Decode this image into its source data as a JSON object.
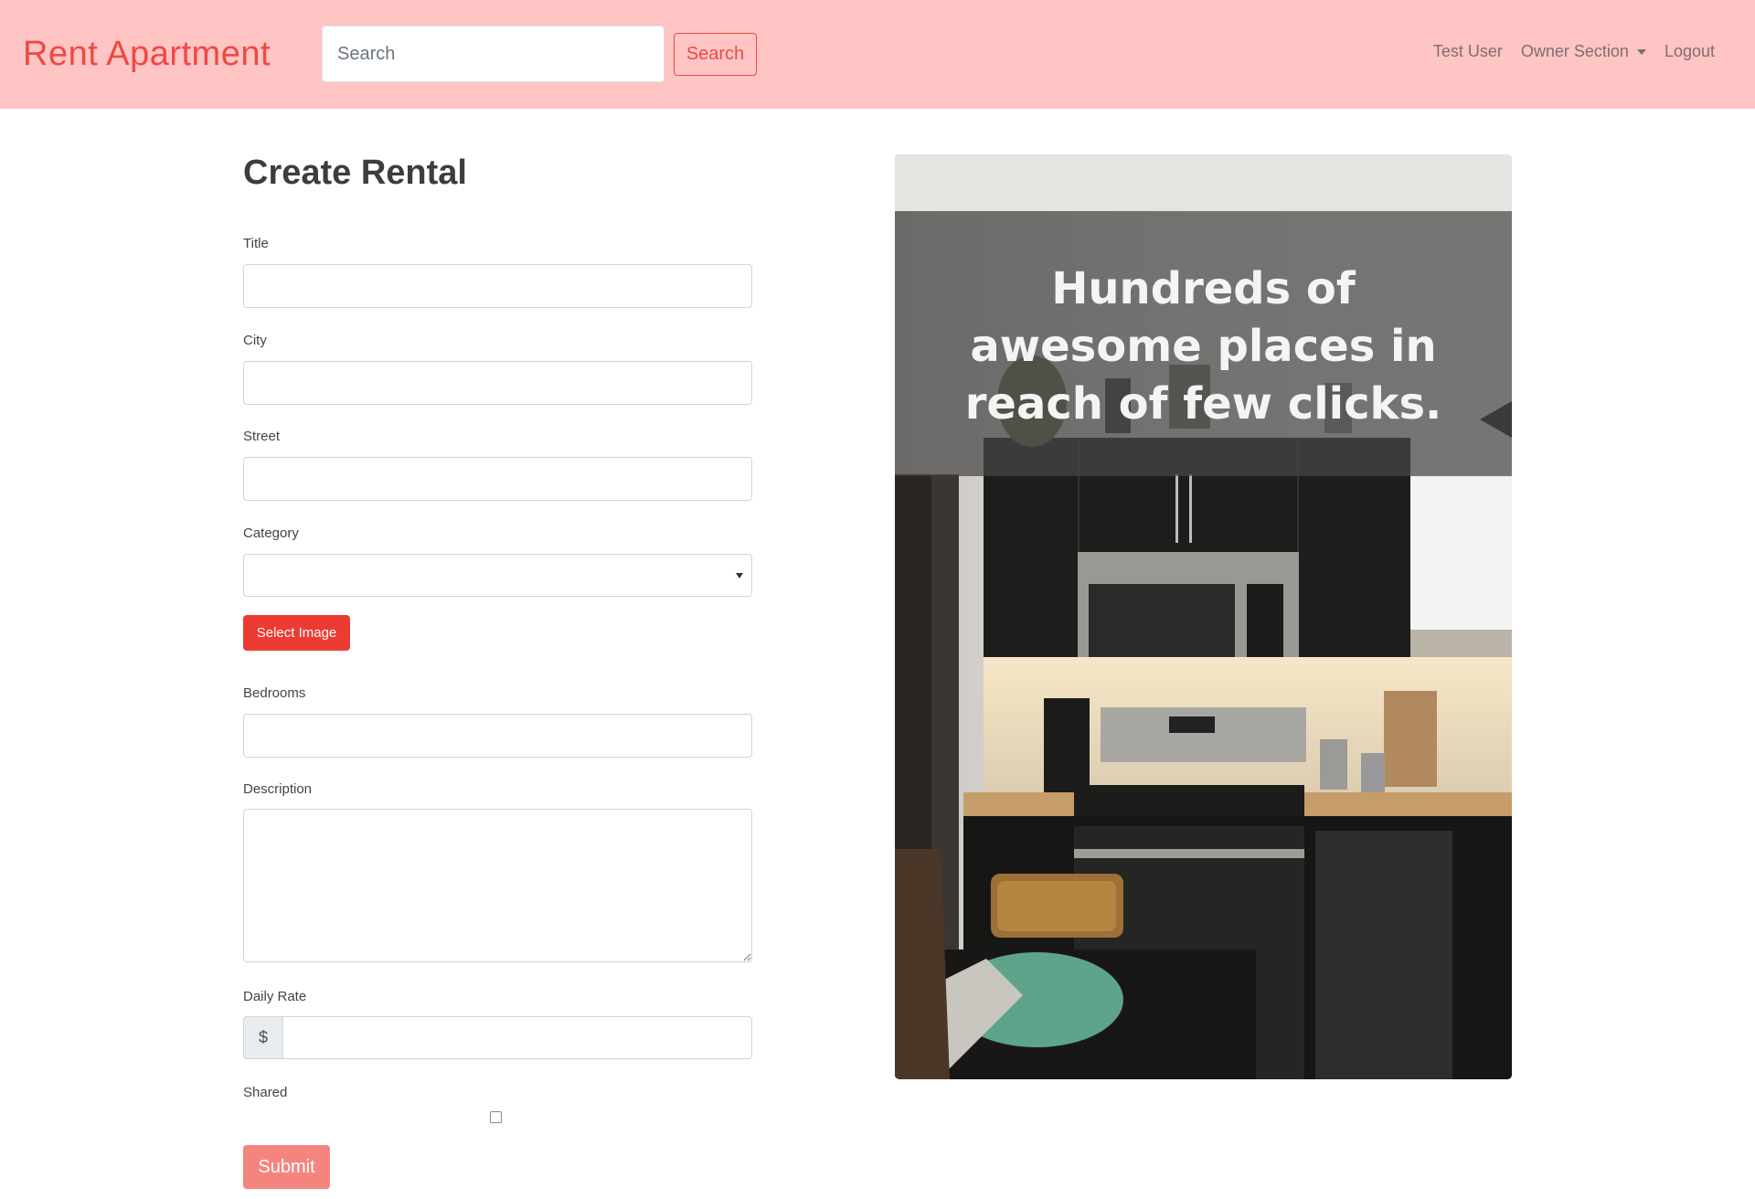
{
  "navbar": {
    "brand": "Rent Apartment",
    "search_placeholder": "Search",
    "search_button": "Search",
    "user_name": "Test User",
    "owner_section": "Owner Section",
    "logout": "Logout"
  },
  "form": {
    "title": "Create Rental",
    "fields": {
      "title_label": "Title",
      "city_label": "City",
      "street_label": "Street",
      "category_label": "Category",
      "category_value": "",
      "select_image_button": "Select Image",
      "bedrooms_label": "Bedrooms",
      "description_label": "Description",
      "daily_rate_label": "Daily Rate",
      "currency_symbol": "$",
      "shared_label": "Shared",
      "shared_checked": false
    },
    "submit_button": "Submit"
  },
  "hero": {
    "headline": "Hundreds of awesome places in reach of few clicks."
  },
  "colors": {
    "navbar_bg": "#ffc4c4",
    "brand": "#ec4a43",
    "primary_button": "#ec3b32",
    "submit_button": "#f6847e"
  }
}
